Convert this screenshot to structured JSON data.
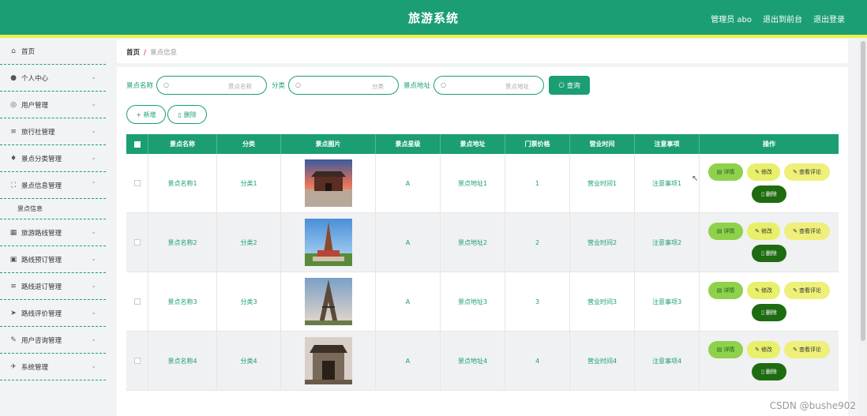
{
  "header": {
    "title": "旅游系统",
    "admin_label": "管理员 abo",
    "front_label": "退出到前台",
    "logout_label": "退出登录"
  },
  "sidebar": {
    "items": [
      {
        "label": "首页",
        "icon": "home-icon",
        "glyph": "⌂",
        "expandable": false
      },
      {
        "label": "个人中心",
        "icon": "user-icon",
        "glyph": "●",
        "expandable": true
      },
      {
        "label": "用户管理",
        "icon": "globe-icon",
        "glyph": "◎",
        "expandable": true
      },
      {
        "label": "旅行社管理",
        "icon": "list-icon",
        "glyph": "≡",
        "expandable": true
      },
      {
        "label": "景点分类管理",
        "icon": "mic-icon",
        "glyph": "♦",
        "expandable": true
      },
      {
        "label": "景点信息管理",
        "icon": "expand-icon",
        "glyph": "⛶",
        "expandable": true,
        "expanded": true
      },
      {
        "label": "旅游路线管理",
        "icon": "grid-icon",
        "glyph": "▦",
        "expandable": true
      },
      {
        "label": "路线预订管理",
        "icon": "clipboard-icon",
        "glyph": "▣",
        "expandable": true
      },
      {
        "label": "路线退订管理",
        "icon": "menu-icon",
        "glyph": "≡",
        "expandable": true
      },
      {
        "label": "路线评价管理",
        "icon": "send-icon",
        "glyph": "➤",
        "expandable": true
      },
      {
        "label": "用户咨询管理",
        "icon": "chat-icon",
        "glyph": "✎",
        "expandable": true
      },
      {
        "label": "系统管理",
        "icon": "navigation-icon",
        "glyph": "✈",
        "expandable": true
      }
    ],
    "sub_item": "景点信息"
  },
  "breadcrumb": {
    "home": "首页",
    "sep": "/",
    "current": "景点信息"
  },
  "search": {
    "name_label": "景点名称",
    "name_placeholder": "景点名称",
    "category_label": "分类",
    "category_placeholder": "分类",
    "address_label": "景点地址",
    "address_placeholder": "景点地址",
    "query_label": "查询"
  },
  "actions": {
    "add_label": "+ 新增",
    "delete_label": "删除"
  },
  "table": {
    "columns": [
      "景点名称",
      "分类",
      "景点图片",
      "景点星级",
      "景点地址",
      "门票价格",
      "营业时间",
      "注意事项",
      "操作"
    ],
    "rows": [
      {
        "name": "景点名称1",
        "category": "分类1",
        "image": "temple-gate",
        "star": "A",
        "address": "景点地址1",
        "price": "1",
        "hours": "营业时间1",
        "notes": "注意事项1"
      },
      {
        "name": "景点名称2",
        "category": "分类2",
        "image": "pagoda",
        "star": "A",
        "address": "景点地址2",
        "price": "2",
        "hours": "营业时间2",
        "notes": "注意事项2"
      },
      {
        "name": "景点名称3",
        "category": "分类3",
        "image": "eiffel-tower",
        "star": "A",
        "address": "景点地址3",
        "price": "3",
        "hours": "营业时间3",
        "notes": "注意事项3"
      },
      {
        "name": "景点名称4",
        "category": "分类4",
        "image": "ancient-gate",
        "star": "A",
        "address": "景点地址4",
        "price": "4",
        "hours": "营业时间4",
        "notes": "注意事项4"
      }
    ],
    "op_detail": "详情",
    "op_edit": "修改",
    "op_comment": "查看评论",
    "op_delete": "删除"
  },
  "watermark": "CSDN @bushe902",
  "colors": {
    "primary": "#1b9e74",
    "accent_yellow": "#e8f14a",
    "detail_green": "#8fd14a",
    "delete_dark": "#1e6b12"
  }
}
